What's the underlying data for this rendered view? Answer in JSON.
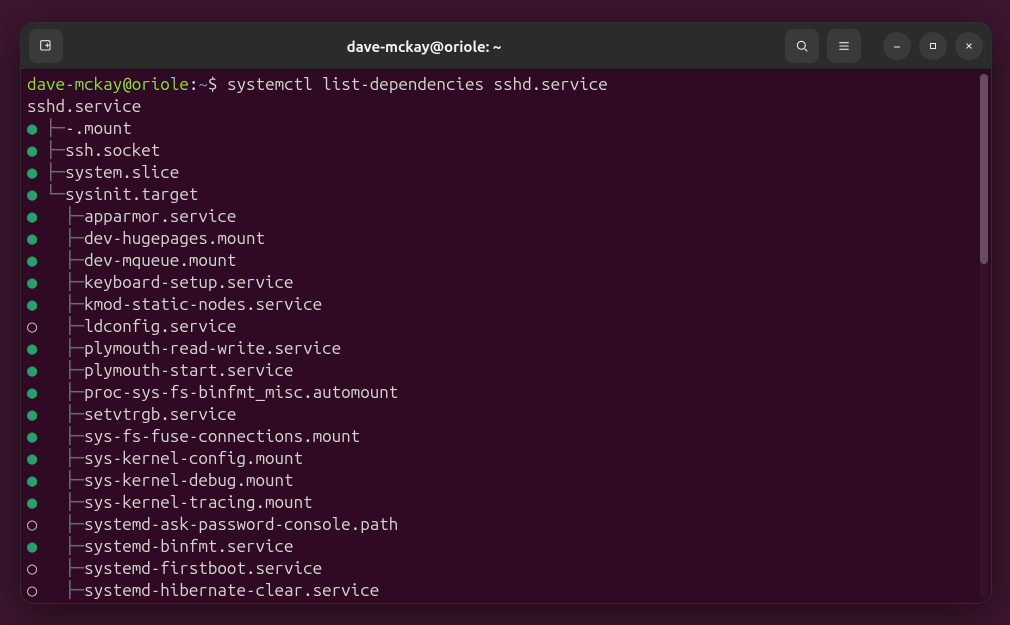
{
  "window": {
    "title": "dave-mckay@oriole: ~"
  },
  "prompt": {
    "user": "dave-mckay",
    "at": "@",
    "host": "oriole",
    "colon": ":",
    "path": "~",
    "symbol": "$",
    "command": "systemctl list-dependencies sshd.service"
  },
  "root_unit": "sshd.service",
  "rows": [
    {
      "status": "on",
      "prefix": " ├─",
      "name": "-.mount"
    },
    {
      "status": "on",
      "prefix": " ├─",
      "name": "ssh.socket"
    },
    {
      "status": "on",
      "prefix": " ├─",
      "name": "system.slice"
    },
    {
      "status": "on",
      "prefix": " └─",
      "name": "sysinit.target"
    },
    {
      "status": "on",
      "prefix": "   ├─",
      "name": "apparmor.service"
    },
    {
      "status": "on",
      "prefix": "   ├─",
      "name": "dev-hugepages.mount"
    },
    {
      "status": "on",
      "prefix": "   ├─",
      "name": "dev-mqueue.mount"
    },
    {
      "status": "on",
      "prefix": "   ├─",
      "name": "keyboard-setup.service"
    },
    {
      "status": "on",
      "prefix": "   ├─",
      "name": "kmod-static-nodes.service"
    },
    {
      "status": "off",
      "prefix": "   ├─",
      "name": "ldconfig.service"
    },
    {
      "status": "on",
      "prefix": "   ├─",
      "name": "plymouth-read-write.service"
    },
    {
      "status": "on",
      "prefix": "   ├─",
      "name": "plymouth-start.service"
    },
    {
      "status": "on",
      "prefix": "   ├─",
      "name": "proc-sys-fs-binfmt_misc.automount"
    },
    {
      "status": "on",
      "prefix": "   ├─",
      "name": "setvtrgb.service"
    },
    {
      "status": "on",
      "prefix": "   ├─",
      "name": "sys-fs-fuse-connections.mount"
    },
    {
      "status": "on",
      "prefix": "   ├─",
      "name": "sys-kernel-config.mount"
    },
    {
      "status": "on",
      "prefix": "   ├─",
      "name": "sys-kernel-debug.mount"
    },
    {
      "status": "on",
      "prefix": "   ├─",
      "name": "sys-kernel-tracing.mount"
    },
    {
      "status": "off",
      "prefix": "   ├─",
      "name": "systemd-ask-password-console.path"
    },
    {
      "status": "on",
      "prefix": "   ├─",
      "name": "systemd-binfmt.service"
    },
    {
      "status": "off",
      "prefix": "   ├─",
      "name": "systemd-firstboot.service"
    },
    {
      "status": "off",
      "prefix": "   ├─",
      "name": "systemd-hibernate-clear.service"
    }
  ],
  "glyphs": {
    "dot_on": "●",
    "dot_off": "○"
  }
}
